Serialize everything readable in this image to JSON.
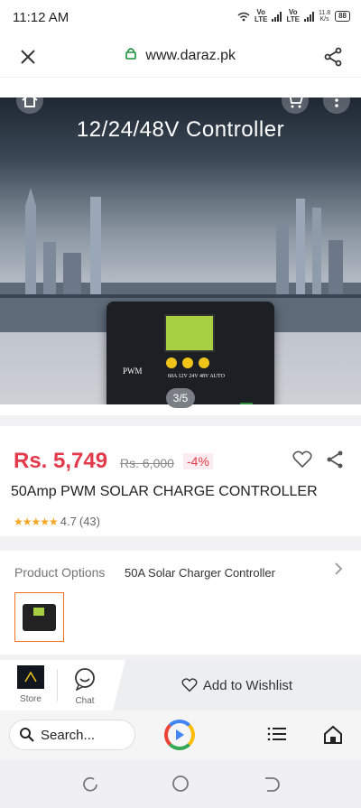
{
  "status": {
    "time": "11:12 AM",
    "sim1": "Vo\nLTE",
    "sim2": "Vo\nLTE",
    "speed": "11.8\nK/s",
    "battery": "88"
  },
  "browser": {
    "url": "www.daraz.pk",
    "search_placeholder": "Search..."
  },
  "gallery": {
    "image_title": "12/24/48V Controller",
    "device_label": "PWM",
    "device_spec": "60A 12V 24V 48V AUTO",
    "counter": "3/5"
  },
  "product": {
    "price": "Rs. 5,749",
    "original_price": "Rs. 6,000",
    "discount": "-4%",
    "name": "50Amp PWM SOLAR CHARGE CONTROLLER",
    "stars": "★★★★★",
    "rating": "4.7",
    "reviews": "(43)"
  },
  "options": {
    "label": "Product Options",
    "value": "50A Solar Charger Controller"
  },
  "actions": {
    "store_label": "Store",
    "chat_label": "Chat",
    "wishlist_label": "Add to Wishlist"
  },
  "colors": {
    "accent": "#f57224",
    "price": "#e23a4a"
  }
}
